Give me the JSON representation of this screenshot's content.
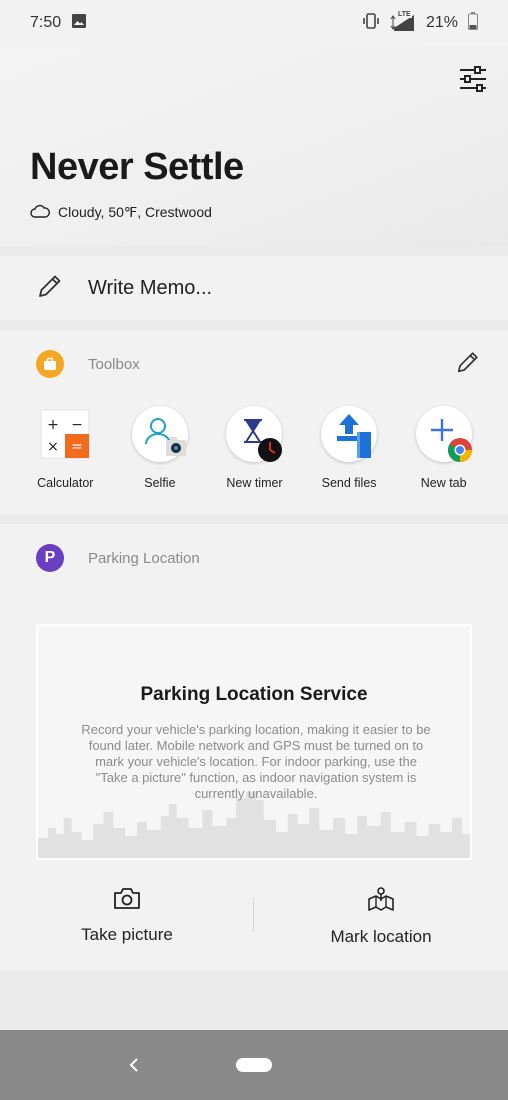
{
  "status_bar": {
    "time": "7:50",
    "left_icons": [
      "image-icon"
    ],
    "right_icons": [
      "vibrate-icon",
      "lte-signal-icon",
      "battery-icon"
    ],
    "network_label": "LTE",
    "battery": "21%"
  },
  "header": {
    "title": "Never Settle",
    "weather": "Cloudy, 50℉, Crestwood",
    "settings_icon": "settings-sliders-icon"
  },
  "memo": {
    "label": "Write Memo...",
    "icon": "pencil-icon"
  },
  "toolbox": {
    "title": "Toolbox",
    "icon": "toolbox-bag-icon",
    "accent_color": "#f5a623",
    "edit_icon": "pencil-icon",
    "calculator_symbols": [
      "+",
      "−",
      "×",
      "="
    ],
    "tools": [
      {
        "label": "Calculator",
        "icon": "calculator-icon"
      },
      {
        "label": "Selfie",
        "icon": "selfie-camera-icon"
      },
      {
        "label": "New timer",
        "icon": "hourglass-icon"
      },
      {
        "label": "Send files",
        "icon": "upload-icon"
      },
      {
        "label": "New tab",
        "icon": "chrome-plus-icon"
      }
    ]
  },
  "parking": {
    "title": "Parking Location",
    "badge_letter": "P",
    "accent_color": "#6a3fc4",
    "service_title": "Parking Location Service",
    "service_desc": "Record your vehicle's parking location, making it easier to be found later. Mobile network and GPS must be turned on to mark your vehicle's location. For indoor parking, use the \"Take a picture\" function, as indoor navigation system is currently unavailable.",
    "actions": [
      {
        "label": "Take picture",
        "icon": "camera-icon"
      },
      {
        "label": "Mark location",
        "icon": "map-pin-icon"
      }
    ]
  },
  "nav_bar": {
    "back_icon": "back-chevron-icon",
    "home_icon": "home-pill-icon"
  }
}
